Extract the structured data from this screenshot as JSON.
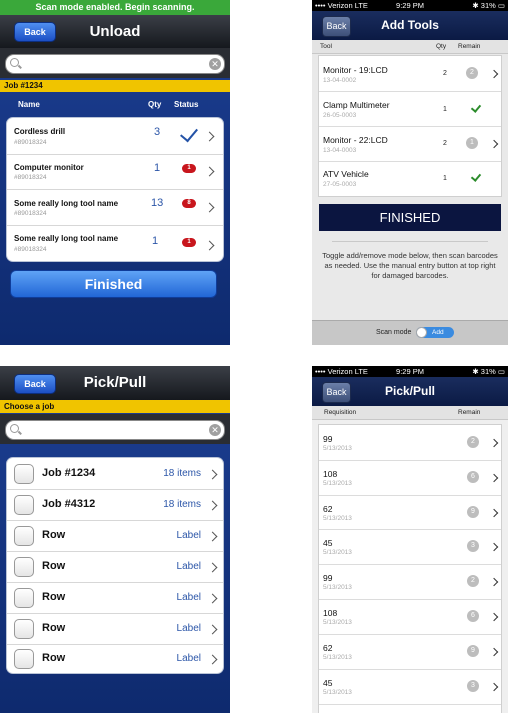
{
  "unload": {
    "banner": "Scan mode enabled. Begin scanning.",
    "back": "Back",
    "title": "Unload",
    "job": "Job #1234",
    "headers": {
      "name": "Name",
      "qty": "Qty",
      "status": "Status"
    },
    "items": [
      {
        "name": "Cordless drill",
        "id": "#89018324",
        "qty": "3",
        "status": "check"
      },
      {
        "name": "Computer monitor",
        "id": "#89018324",
        "qty": "1",
        "status": "1"
      },
      {
        "name": "Some really long tool name",
        "id": "#89018324",
        "qty": "13",
        "status": "8"
      },
      {
        "name": "Some really long tool name",
        "id": "#89018324",
        "qty": "1",
        "status": "1"
      }
    ],
    "finished": "Finished"
  },
  "add_tools": {
    "status": {
      "carrier": "Verizon",
      "network": "LTE",
      "time": "9:29 PM",
      "battery": "31%"
    },
    "back": "Back",
    "title": "Add Tools",
    "headers": {
      "tool": "Tool",
      "qty": "Qty",
      "remain": "Remain"
    },
    "items": [
      {
        "name": "Monitor - 19:LCD",
        "date": "13-04-0002",
        "qty": "2",
        "remain": "2"
      },
      {
        "name": "Clamp Multimeter",
        "date": "26-05-0003",
        "qty": "1",
        "remain": "check"
      },
      {
        "name": "Monitor - 22:LCD",
        "date": "13-04-0003",
        "qty": "2",
        "remain": "1"
      },
      {
        "name": "ATV Vehicle",
        "date": "27-05-0003",
        "qty": "1",
        "remain": "check"
      }
    ],
    "finished": "FINISHED",
    "instructions": "Toggle add/remove mode below, then scan barcodes as needed. Use the manual entry button at top right for damaged barcodes.",
    "scan_mode_label": "Scan mode",
    "scan_mode_value": "Add"
  },
  "pick_pull_jobs": {
    "back": "Back",
    "title": "Pick/Pull",
    "subtitle": "Choose a job",
    "rows": [
      {
        "name": "Job #1234",
        "right": "18 items"
      },
      {
        "name": "Job #4312",
        "right": "18 items"
      },
      {
        "name": "Row",
        "right": "Label"
      },
      {
        "name": "Row",
        "right": "Label"
      },
      {
        "name": "Row",
        "right": "Label"
      },
      {
        "name": "Row",
        "right": "Label"
      },
      {
        "name": "Row",
        "right": "Label"
      }
    ]
  },
  "pick_pull_req": {
    "status": {
      "carrier": "Verizon",
      "network": "LTE",
      "time": "9:29 PM",
      "battery": "31%"
    },
    "back": "Back",
    "title": "Pick/Pull",
    "headers": {
      "requisition": "Requisition",
      "remain": "Remain"
    },
    "rows": [
      {
        "req": "99",
        "date": "5/13/2013",
        "remain": "2"
      },
      {
        "req": "108",
        "date": "5/13/2013",
        "remain": "6"
      },
      {
        "req": "62",
        "date": "5/13/2013",
        "remain": "9"
      },
      {
        "req": "45",
        "date": "5/13/2013",
        "remain": "3"
      },
      {
        "req": "99",
        "date": "5/13/2013",
        "remain": "2"
      },
      {
        "req": "108",
        "date": "5/13/2013",
        "remain": "6"
      },
      {
        "req": "62",
        "date": "5/13/2013",
        "remain": "9"
      },
      {
        "req": "45",
        "date": "5/13/2013",
        "remain": "3"
      }
    ]
  }
}
